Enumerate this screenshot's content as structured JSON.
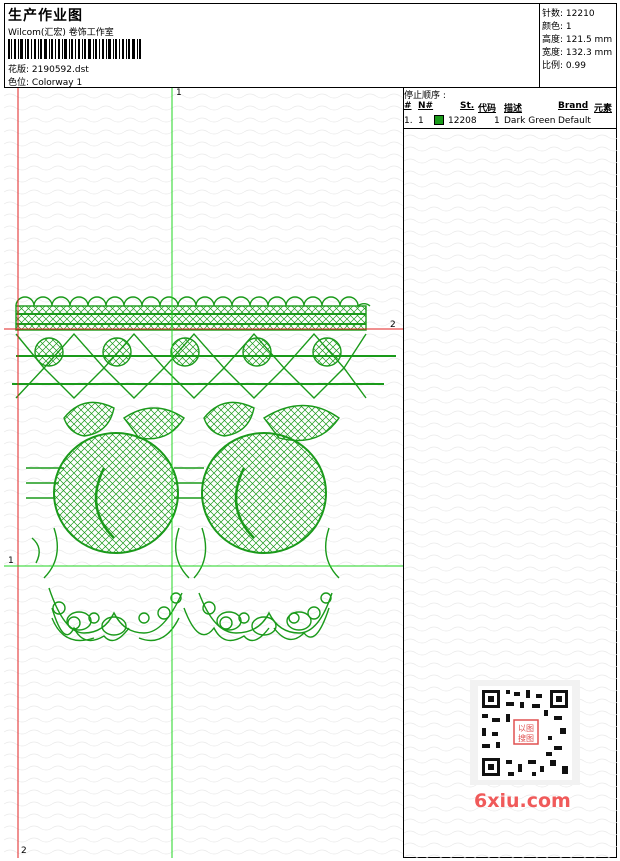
{
  "header": {
    "title": "生产作业图",
    "studio": "Wilcom(汇宏) 卷饰工作室",
    "design_label": "花版:",
    "design_value": "2190592.dst",
    "colorway_label": "色位:",
    "colorway_value": "Colorway 1"
  },
  "stats": [
    {
      "label": "针数:",
      "value": "12210"
    },
    {
      "label": "颜色:",
      "value": "1"
    },
    {
      "label": "高度:",
      "value": "121.5 mm"
    },
    {
      "label": "宽度:",
      "value": "132.3 mm"
    },
    {
      "label": "比例:",
      "value": "0.99"
    }
  ],
  "stop_sequence": {
    "title": "停止顺序 :",
    "columns": [
      "#",
      "N#",
      "St.",
      "代码",
      "描述",
      "Brand",
      "元素"
    ],
    "rows": [
      {
        "index": "1.",
        "n": "1",
        "stitches": "12208",
        "code": "1",
        "description": "Dark Green",
        "brand": "Default"
      }
    ]
  },
  "guides": {
    "top_label": "1",
    "right_label": "2",
    "left_label": "1",
    "bottom_label": "2"
  },
  "watermark": "6xiu.com",
  "qr_badge": "以图\n搜图",
  "colors": {
    "stitch": "#1a9a1a",
    "guide_green": "#22d422",
    "guide_red": "#e02020",
    "swatch": "#1a9a1a"
  }
}
